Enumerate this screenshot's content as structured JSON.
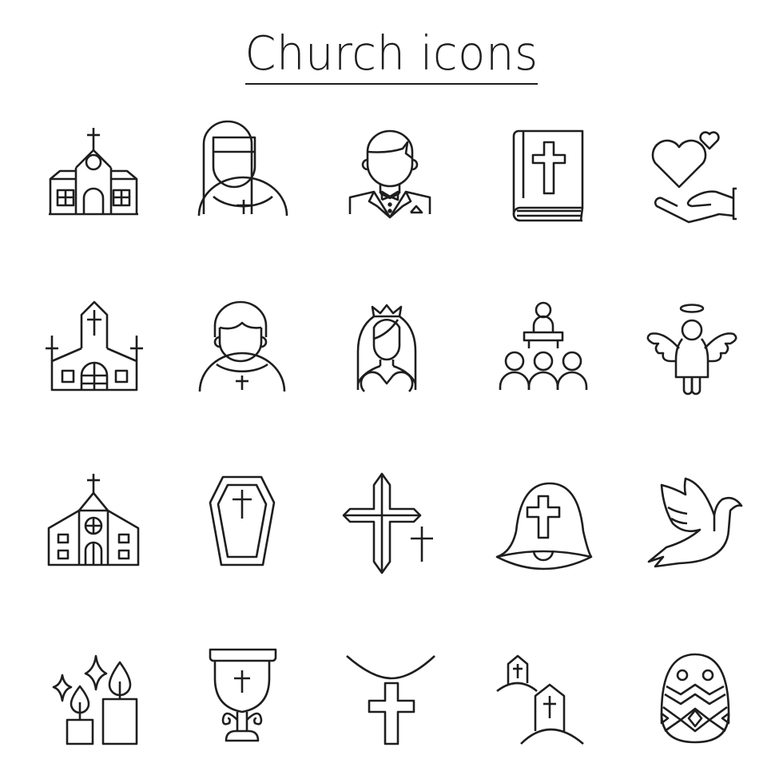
{
  "title": "Church icons",
  "line_color": "#1e1e1e",
  "background_color": "#ffffff",
  "icons": [
    {
      "row": 1,
      "col": 1,
      "name": "church-building-icon"
    },
    {
      "row": 1,
      "col": 2,
      "name": "nun-icon"
    },
    {
      "row": 1,
      "col": 3,
      "name": "groom-icon"
    },
    {
      "row": 1,
      "col": 4,
      "name": "bible-icon"
    },
    {
      "row": 1,
      "col": 5,
      "name": "hand-hearts-icon"
    },
    {
      "row": 2,
      "col": 1,
      "name": "chapel-icon"
    },
    {
      "row": 2,
      "col": 2,
      "name": "priest-icon"
    },
    {
      "row": 2,
      "col": 3,
      "name": "bride-icon"
    },
    {
      "row": 2,
      "col": 4,
      "name": "sermon-congregation-icon"
    },
    {
      "row": 2,
      "col": 5,
      "name": "angel-icon"
    },
    {
      "row": 3,
      "col": 1,
      "name": "cathedral-icon"
    },
    {
      "row": 3,
      "col": 2,
      "name": "coffin-icon"
    },
    {
      "row": 3,
      "col": 3,
      "name": "crosses-icon"
    },
    {
      "row": 3,
      "col": 4,
      "name": "church-bell-icon"
    },
    {
      "row": 3,
      "col": 5,
      "name": "dove-icon"
    },
    {
      "row": 4,
      "col": 1,
      "name": "candles-icon"
    },
    {
      "row": 4,
      "col": 2,
      "name": "chalice-icon"
    },
    {
      "row": 4,
      "col": 3,
      "name": "cross-necklace-icon"
    },
    {
      "row": 4,
      "col": 4,
      "name": "graves-icon"
    },
    {
      "row": 4,
      "col": 5,
      "name": "easter-egg-icon"
    }
  ]
}
